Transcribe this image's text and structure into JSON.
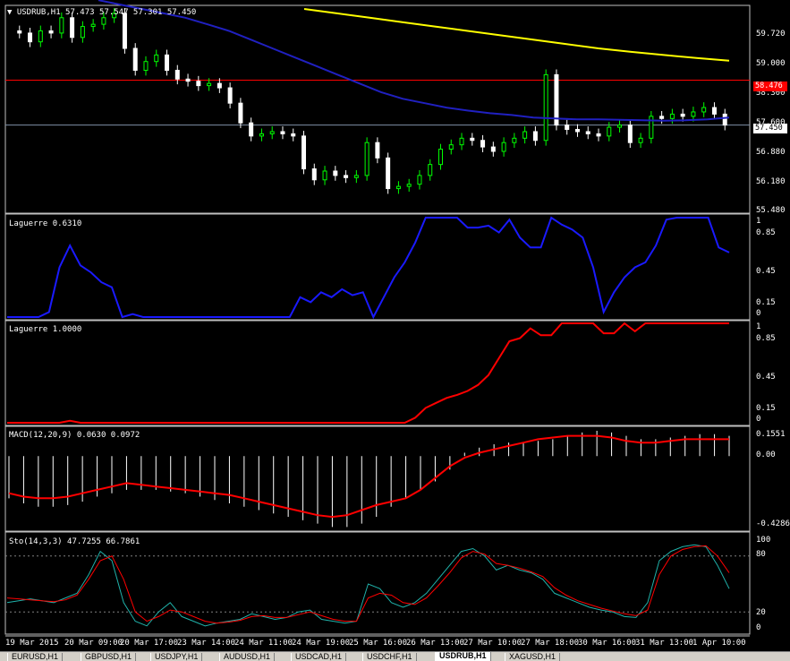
{
  "header": {
    "symbol": "USDRUB,H1",
    "ohlc": "57.473 57.547 57.301 57.450"
  },
  "price_axis": {
    "labels": [
      "59.720",
      "59.000",
      "58.300",
      "57.600",
      "56.880",
      "56.180",
      "55.480"
    ],
    "red_line_label": "58.476",
    "current_label": "57.450"
  },
  "panels": {
    "laguerre1": {
      "title": "Laguerre 0.6310",
      "labels": [
        "1",
        "0.85",
        "0.45",
        "0.15",
        "0"
      ]
    },
    "laguerre2": {
      "title": "Laguerre 1.0000",
      "labels": [
        "1",
        "0.85",
        "0.45",
        "0.15",
        "0"
      ]
    },
    "macd": {
      "title": "MACD(12,20,9) 0.0630 0.0972",
      "labels": [
        "0.1551",
        "0.00",
        "-0.4286"
      ]
    },
    "stoch": {
      "title": "Sto(14,3,3) 47.7255 66.7861",
      "labels": [
        "100",
        "80",
        "20",
        "0"
      ]
    }
  },
  "time_axis": [
    "19 Mar 2015",
    "20 Mar 09:00",
    "20 Mar 17:00",
    "23 Mar 14:00",
    "24 Mar 11:00",
    "24 Mar 19:00",
    "25 Mar 16:00",
    "26 Mar 13:00",
    "27 Mar 10:00",
    "27 Mar 18:00",
    "30 Mar 16:00",
    "31 Mar 13:00",
    "1 Apr 10:00"
  ],
  "tabs": [
    {
      "label": "EURUSD,H1",
      "active": false
    },
    {
      "label": "GBPUSD,H1",
      "active": false
    },
    {
      "label": "USDJPY,H1",
      "active": false
    },
    {
      "label": "AUDUSD,H1",
      "active": false
    },
    {
      "label": "USDCAD,H1",
      "active": false
    },
    {
      "label": "USDCHF,H1",
      "active": false
    },
    {
      "label": "USDRUB,H1",
      "active": true
    },
    {
      "label": "XAGUSD,H1",
      "active": false
    }
  ],
  "colors": {
    "background": "#000000",
    "bull": "#00ff00",
    "bear": "#ffffff",
    "ma_blue": "#2020c0",
    "ma_yellow": "#ffff00",
    "red_line": "#ff0000",
    "current_line": "#7f8fa6",
    "laguerre1": "#1a1aff",
    "laguerre2": "#ff0000",
    "macd_signal": "#ff0000",
    "stoch_main": "#20b2aa",
    "stoch_signal": "#ff0000"
  },
  "chart_data": {
    "type": "line",
    "price": {
      "ylim": [
        55.48,
        60.1
      ],
      "red_line": 58.476,
      "current": 57.45,
      "close_path": [
        59.6,
        59.55,
        59.35,
        59.6,
        59.55,
        59.9,
        59.45,
        59.7,
        59.75,
        59.9,
        60.0,
        59.2,
        58.7,
        58.9,
        59.05,
        58.7,
        58.5,
        58.45,
        58.35,
        58.4,
        58.3,
        57.95,
        57.5,
        57.2,
        57.25,
        57.3,
        57.25,
        57.2,
        56.45,
        56.2,
        56.4,
        56.3,
        56.25,
        56.3,
        57.05,
        56.7,
        56.0,
        56.05,
        56.1,
        56.3,
        56.55,
        56.9,
        57.0,
        57.15,
        57.1,
        56.95,
        56.85,
        57.05,
        57.15,
        57.3,
        57.1,
        58.6,
        57.45,
        57.35,
        57.3,
        57.25,
        57.2,
        57.4,
        57.45,
        57.05,
        57.15,
        57.65,
        57.6,
        57.7,
        57.65,
        57.75,
        57.85,
        57.7,
        57.45
      ],
      "ma_blue": [
        60.3,
        60.2,
        60.1,
        60.0,
        59.9,
        59.75,
        59.6,
        59.4,
        59.2,
        59.0,
        58.8,
        58.6,
        58.4,
        58.2,
        58.05,
        57.95,
        57.85,
        57.78,
        57.72,
        57.68,
        57.62,
        57.6,
        57.58,
        57.58,
        57.57,
        57.56,
        57.55,
        57.56,
        57.58,
        57.62
      ],
      "ma_yellow": [
        60.1,
        60.0,
        59.9,
        59.8,
        59.7,
        59.6,
        59.5,
        59.4,
        59.3,
        59.2,
        59.12,
        59.05,
        58.98,
        58.92
      ]
    },
    "laguerre1": [
      0,
      0,
      0,
      0,
      0.05,
      0.5,
      0.72,
      0.52,
      0.45,
      0.35,
      0.3,
      0,
      0.03,
      0,
      0,
      0,
      0,
      0,
      0,
      0,
      0,
      0,
      0,
      0,
      0,
      0,
      0,
      0,
      0.2,
      0.15,
      0.25,
      0.2,
      0.28,
      0.22,
      0.25,
      0,
      0.2,
      0.4,
      0.55,
      0.75,
      1,
      1,
      1,
      1,
      0.9,
      0.9,
      0.92,
      0.85,
      0.98,
      0.8,
      0.7,
      0.7,
      1,
      0.93,
      0.88,
      0.8,
      0.5,
      0.05,
      0.25,
      0.4,
      0.5,
      0.55,
      0.72,
      0.98,
      1,
      1,
      1,
      1,
      0.7,
      0.65
    ],
    "laguerre2": [
      0,
      0,
      0,
      0,
      0,
      0,
      0.02,
      0,
      0,
      0,
      0,
      0,
      0,
      0,
      0,
      0,
      0,
      0,
      0,
      0,
      0,
      0,
      0,
      0,
      0,
      0,
      0,
      0,
      0,
      0,
      0,
      0,
      0,
      0,
      0,
      0,
      0,
      0,
      0,
      0.05,
      0.15,
      0.2,
      0.25,
      0.28,
      0.32,
      0.38,
      0.48,
      0.65,
      0.82,
      0.85,
      0.95,
      0.88,
      0.88,
      1,
      1,
      1,
      1,
      0.9,
      0.9,
      1,
      0.92,
      1,
      1,
      1,
      1,
      1,
      1,
      1,
      1,
      1
    ],
    "macd": {
      "ylim": [
        -0.4286,
        0.1551
      ],
      "histogram": [
        -0.25,
        -0.28,
        -0.3,
        -0.3,
        -0.29,
        -0.27,
        -0.24,
        -0.22,
        -0.2,
        -0.2,
        -0.2,
        -0.21,
        -0.22,
        -0.24,
        -0.26,
        -0.28,
        -0.3,
        -0.32,
        -0.34,
        -0.36,
        -0.38,
        -0.4,
        -0.42,
        -0.42,
        -0.4,
        -0.36,
        -0.3,
        -0.25,
        -0.2,
        -0.15,
        -0.08,
        0.02,
        0.05,
        0.07,
        0.08,
        0.08,
        0.09,
        0.1,
        0.12,
        0.14,
        0.15,
        0.14,
        0.12,
        0.1,
        0.1,
        0.11,
        0.12,
        0.13,
        0.13,
        0.12
      ],
      "signal": [
        -0.22,
        -0.24,
        -0.25,
        -0.25,
        -0.24,
        -0.22,
        -0.2,
        -0.18,
        -0.16,
        -0.17,
        -0.18,
        -0.19,
        -0.2,
        -0.21,
        -0.22,
        -0.23,
        -0.25,
        -0.27,
        -0.29,
        -0.31,
        -0.33,
        -0.35,
        -0.36,
        -0.35,
        -0.32,
        -0.29,
        -0.27,
        -0.25,
        -0.2,
        -0.13,
        -0.06,
        -0.01,
        0.02,
        0.04,
        0.06,
        0.08,
        0.1,
        0.11,
        0.12,
        0.12,
        0.12,
        0.11,
        0.09,
        0.08,
        0.08,
        0.09,
        0.1,
        0.1,
        0.1,
        0.1
      ]
    },
    "stoch": {
      "main": [
        30,
        32,
        34,
        32,
        30,
        35,
        40,
        60,
        85,
        75,
        30,
        10,
        5,
        20,
        30,
        15,
        10,
        5,
        8,
        10,
        12,
        18,
        15,
        12,
        14,
        20,
        22,
        12,
        10,
        8,
        10,
        50,
        45,
        30,
        25,
        30,
        40,
        55,
        70,
        85,
        88,
        80,
        65,
        70,
        65,
        62,
        55,
        40,
        35,
        30,
        25,
        22,
        20,
        15,
        14,
        30,
        75,
        85,
        90,
        92,
        90,
        70,
        45
      ],
      "signal": [
        35,
        34,
        33,
        32,
        31,
        33,
        38,
        55,
        75,
        80,
        55,
        20,
        10,
        15,
        22,
        20,
        15,
        10,
        8,
        9,
        11,
        15,
        16,
        14,
        14,
        17,
        20,
        16,
        12,
        10,
        10,
        35,
        40,
        38,
        30,
        28,
        35,
        48,
        62,
        78,
        85,
        82,
        72,
        70,
        67,
        63,
        58,
        46,
        38,
        32,
        28,
        24,
        21,
        18,
        16,
        22,
        60,
        80,
        87,
        90,
        91,
        80,
        62
      ]
    }
  }
}
